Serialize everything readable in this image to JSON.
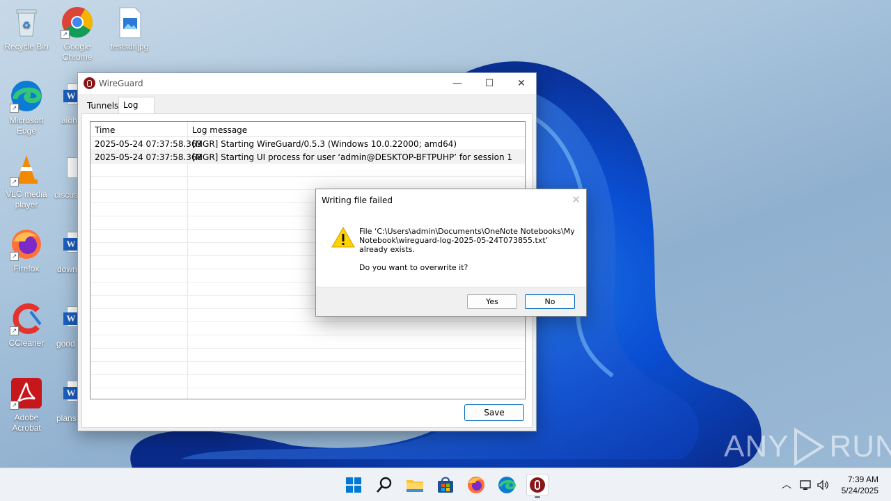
{
  "desktop": {
    "icons": [
      {
        "label": "Recycle Bin"
      },
      {
        "label": "Google Chrome"
      },
      {
        "label": "testsdr.jpg"
      },
      {
        "label": "Microsoft Edge"
      },
      {
        "label": "VLC media player"
      },
      {
        "label": "Firefox"
      },
      {
        "label": "CCleaner"
      },
      {
        "label": "Adobe Acrobat"
      }
    ],
    "partial_labels": [
      "aloh",
      "discus",
      "down",
      "good",
      "plansl"
    ]
  },
  "wireguard": {
    "title": "WireGuard",
    "tabs": [
      {
        "label": "Tunnels"
      },
      {
        "label": "Log"
      }
    ],
    "active_tab": "Log",
    "log": {
      "columns": [
        "Time",
        "Log message"
      ],
      "rows": [
        {
          "time": "2025-05-24 07:37:58.363",
          "message": "[MGR] Starting WireGuard/0.5.3 (Windows 10.0.22000; amd64)"
        },
        {
          "time": "2025-05-24 07:37:58.368",
          "message": "[MGR] Starting UI process for user ‘admin@DESKTOP-BFTPUHP’ for session 1"
        }
      ]
    },
    "save_label": "Save"
  },
  "dialog": {
    "title": "Writing file failed",
    "message": "File ‘C:\\Users\\admin\\Documents\\OneNote Notebooks\\My Notebook\\wireguard-log-2025-05-24T073855.txt’ already exists.",
    "question": "Do you want to overwrite it?",
    "yes_label": "Yes",
    "no_label": "No"
  },
  "watermark": {
    "left": "ANY",
    "right": "RUN"
  },
  "taskbar": {
    "clock_time": "7:39 AM",
    "clock_date": "5/24/2025"
  },
  "colors": {
    "accent": "#0067c0",
    "wireguard_red": "#88171a"
  }
}
